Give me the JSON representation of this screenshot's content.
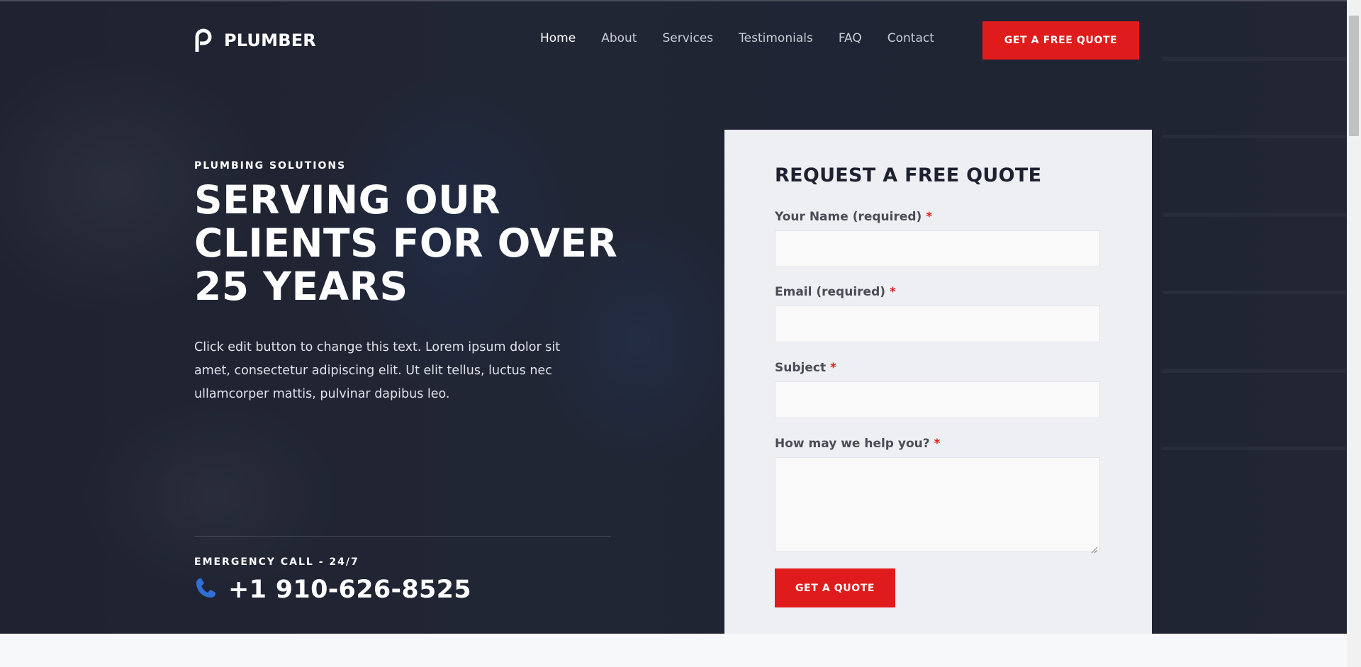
{
  "brand": {
    "name": "PLUMBER",
    "icon": "logo-p-icon"
  },
  "nav": {
    "items": [
      {
        "label": "Home",
        "active": true
      },
      {
        "label": "About",
        "active": false
      },
      {
        "label": "Services",
        "active": false
      },
      {
        "label": "Testimonials",
        "active": false
      },
      {
        "label": "FAQ",
        "active": false
      },
      {
        "label": "Contact",
        "active": false
      }
    ],
    "cta_label": "GET A FREE QUOTE"
  },
  "hero": {
    "eyebrow": "PLUMBING SOLUTIONS",
    "headline_lines": [
      "SERVING OUR",
      "CLIENTS FOR OVER",
      "25 YEARS"
    ],
    "lead": "Click edit button to change this text. Lorem ipsum dolor sit amet, consectetur adipiscing elit. Ut elit tellus, luctus nec ullamcorper mattis, pulvinar dapibus leo.",
    "emergency_label": "EMERGENCY CALL - 24/7",
    "phone": "+1 910-626-8525",
    "phone_icon": "phone-icon"
  },
  "form": {
    "title": "REQUEST A FREE QUOTE",
    "fields": [
      {
        "label": "Your Name (required)",
        "required_mark": "*",
        "value": "",
        "placeholder": ""
      },
      {
        "label": "Email (required)",
        "required_mark": "*",
        "value": "",
        "placeholder": ""
      },
      {
        "label": "Subject",
        "required_mark": "*",
        "value": "",
        "placeholder": ""
      },
      {
        "label": "How may we help you?",
        "required_mark": "*",
        "value": "",
        "placeholder": ""
      }
    ],
    "submit_label": "GET A QUOTE"
  },
  "colors": {
    "accent": "#e01b1b",
    "phone_icon": "#2f6fd6",
    "card_bg": "#eeeff3",
    "hero_bg": "#2a2e3c"
  }
}
